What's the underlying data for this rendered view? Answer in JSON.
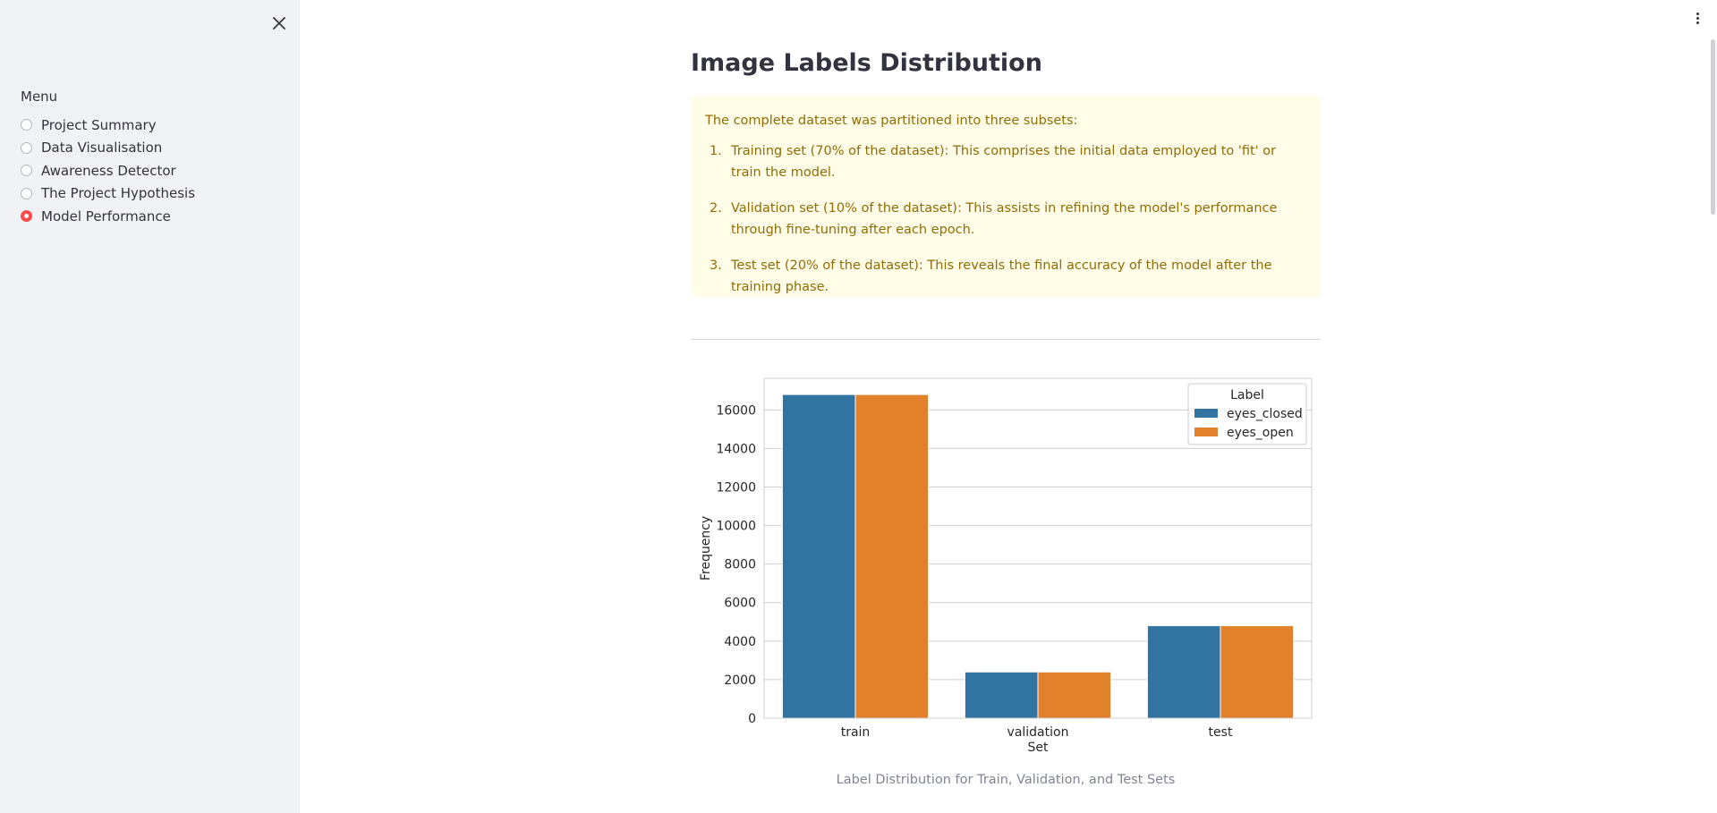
{
  "sidebar": {
    "menu_label": "Menu",
    "items": [
      {
        "label": "Project Summary",
        "selected": false
      },
      {
        "label": "Data Visualisation",
        "selected": false
      },
      {
        "label": "Awareness Detector",
        "selected": false
      },
      {
        "label": "The Project Hypothesis",
        "selected": false
      },
      {
        "label": "Model Performance",
        "selected": true
      }
    ],
    "accent_color": "#ff4b4b"
  },
  "main": {
    "title": "Image Labels Distribution",
    "alert": {
      "intro": "The complete dataset was partitioned into three subsets:",
      "items": [
        {
          "num": "1.",
          "text": "Training set (70% of the dataset): This comprises the initial data employed to 'fit' or train the model."
        },
        {
          "num": "2.",
          "text": "Validation set (10% of the dataset): This assists in refining the model's performance through fine-tuning after each epoch."
        },
        {
          "num": "3.",
          "text": "Test set (20% of the dataset): This reveals the final accuracy of the model after the training phase."
        }
      ]
    },
    "caption": "Label Distribution for Train, Validation, and Test Sets"
  },
  "chart_data": {
    "type": "bar",
    "categories": [
      "train",
      "validation",
      "test"
    ],
    "series": [
      {
        "name": "eyes_closed",
        "values": [
          16800,
          2400,
          4800
        ],
        "color": "#3274a1"
      },
      {
        "name": "eyes_open",
        "values": [
          16800,
          2400,
          4800
        ],
        "color": "#e1812c"
      }
    ],
    "xlabel": "Set",
    "ylabel": "Frequency",
    "yticks": [
      0,
      2000,
      4000,
      6000,
      8000,
      10000,
      12000,
      14000,
      16000
    ],
    "ylim": [
      0,
      17640
    ],
    "grid": true,
    "legend": {
      "title": "Label",
      "placement": "top-right"
    }
  }
}
